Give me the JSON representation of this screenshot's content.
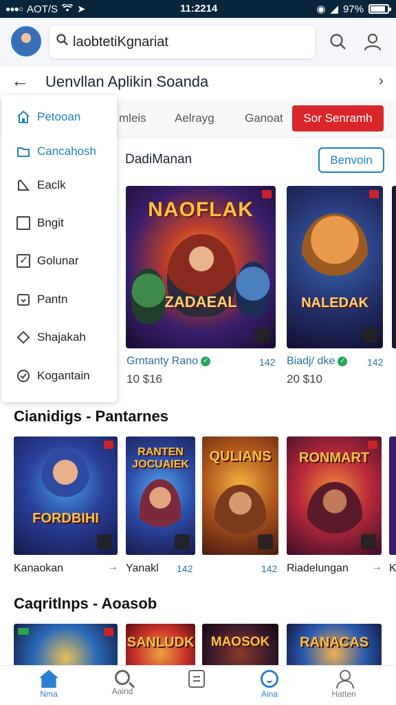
{
  "status_bar": {
    "carrier": "AOT/S",
    "time": "11:2214",
    "battery": "97%"
  },
  "header": {
    "search_value": "laobtetiKgnariat"
  },
  "title_bar": {
    "title": "Uenvllan Aplikin Soanda"
  },
  "tabs": [
    "mleis",
    "Aelrayg",
    "Ganoat",
    "Sor Senramh"
  ],
  "dropdown": {
    "items": [
      "Petooan",
      "Cancahosh",
      "Eaclk",
      "Bngit",
      "Golunar",
      "Pantn",
      "Shajakah",
      "Kogantain"
    ]
  },
  "section1": {
    "title": "DadiManan",
    "button": "Benvoin",
    "cards": [
      {
        "art_title": "NAOFLAK",
        "art_sub": "ZADAEAL",
        "name": "Grntanty Rano",
        "meta": "142",
        "price": "10 $16"
      },
      {
        "art_title": "",
        "art_sub": "NALEDAK",
        "name": "Biadj/ dke",
        "meta": "142",
        "price": "20 $10"
      }
    ]
  },
  "section2": {
    "title": "Cianidigs - Pantarnes",
    "tiles": [
      {
        "art": "FORDBIHI",
        "caption": "Kanaokan"
      },
      {
        "art": "RANTEN JOCUAIEK",
        "caption": "Yanakl",
        "num": "142"
      },
      {
        "art": "QULIANS",
        "caption": "",
        "num": "142"
      },
      {
        "art": "RONMART",
        "caption": "Riadelungan"
      }
    ]
  },
  "section3": {
    "title": "Caqritlnps - Aoasob",
    "tiles": [
      {
        "art": ""
      },
      {
        "art": "SANLUDK"
      },
      {
        "art": "MAOSOK"
      },
      {
        "art": "RANACAS"
      }
    ]
  },
  "bottom_nav": [
    "Nma",
    "Aaind",
    "",
    "Aina",
    "Hatten"
  ],
  "colors": {
    "status_bar": "#08253b",
    "accent_blue": "#2082b8",
    "active_tab_red": "#d9262a",
    "nav_active": "#2b7fd0"
  }
}
